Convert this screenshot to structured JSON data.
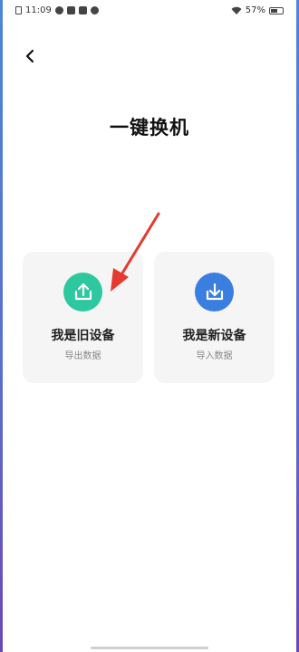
{
  "status_bar": {
    "time": "11:09",
    "battery_text": "57%",
    "battery_level": 0.57,
    "left_icons": [
      "sim-icon",
      "notification-icon",
      "app-icon",
      "message-icon",
      "qq-icon"
    ],
    "right_icons": [
      "wifi-icon",
      "battery-icon"
    ]
  },
  "header": {
    "back_icon": "chevron-left-icon",
    "title": "一键换机"
  },
  "options": {
    "old_device": {
      "title": "我是旧设备",
      "subtitle": "导出数据",
      "icon": "upload-icon",
      "color": "#2ec8a0"
    },
    "new_device": {
      "title": "我是新设备",
      "subtitle": "导入数据",
      "icon": "download-icon",
      "color": "#3a7ee0"
    }
  },
  "annotation": {
    "arrow_color": "#e53a2f",
    "points_to": "old_device"
  }
}
